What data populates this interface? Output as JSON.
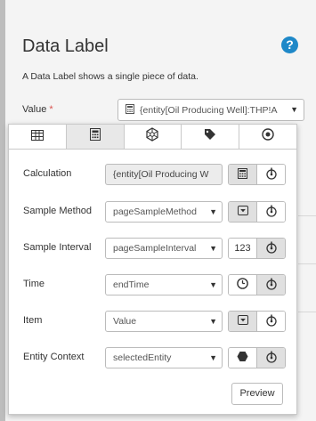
{
  "header": {
    "title": "Data Label",
    "help": "?",
    "description": "A Data Label shows a single piece of data."
  },
  "value_field": {
    "label": "Value",
    "required_mark": "*",
    "value": "{entity[Oil Producing Well]:THP!A"
  },
  "tabs": [
    {
      "icon": "table-icon",
      "active": false
    },
    {
      "icon": "calculator-icon",
      "active": true
    },
    {
      "icon": "hexagon-network-icon",
      "active": false
    },
    {
      "icon": "tag-icon",
      "active": false
    },
    {
      "icon": "radio-target-icon",
      "active": false
    }
  ],
  "rows": {
    "calculation": {
      "label": "Calculation",
      "value": "{entity[Oil Producing W",
      "btn1": "calculator-icon",
      "btn2": "pin-icon"
    },
    "sample_method": {
      "label": "Sample Method",
      "value": "pageSampleMethod",
      "btn1": "dropdown-box-icon",
      "btn2": "pin-icon"
    },
    "sample_interval": {
      "label": "Sample Interval",
      "value": "pageSampleInterval",
      "btn1_text": "123",
      "btn2": "pin-icon"
    },
    "time": {
      "label": "Time",
      "value": "endTime",
      "btn1": "clock-icon",
      "btn2": "pin-icon"
    },
    "item": {
      "label": "Item",
      "value": "Value",
      "btn1": "dropdown-box-icon",
      "btn2": "pin-icon"
    },
    "entity_context": {
      "label": "Entity Context",
      "value": "selectedEntity",
      "btn1": "hexagon-icon",
      "btn2": "pin-icon"
    }
  },
  "preview_label": "Preview",
  "caret": "▼"
}
